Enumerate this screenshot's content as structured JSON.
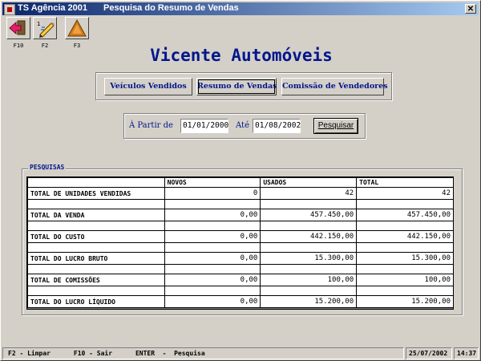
{
  "window": {
    "title_app": "TS Agência 2001",
    "title_screen": "Pesquisa do Resumo de Vendas",
    "close_symbol": "✕"
  },
  "toolbar": {
    "buttons": [
      {
        "icon": "exit-door-arrow-icon",
        "key": "F10"
      },
      {
        "icon": "eraser-pencil-icon",
        "key": "F2"
      },
      {
        "icon": "triangle-icon",
        "key": "F3"
      }
    ]
  },
  "heading": "Vicente Automóveis",
  "nav": {
    "items": [
      {
        "label": "Veículos Vendidos"
      },
      {
        "label": "Resumo de Vendas"
      },
      {
        "label": "Comissão de Vendedores"
      }
    ]
  },
  "filter": {
    "from_label": "À Partir de",
    "from_value": "01/01/2000",
    "to_label": "Até",
    "to_value": "01/08/2002",
    "search_label": "Pesquisar"
  },
  "results": {
    "group_label": "PESQUISAS",
    "columns": [
      "NOVOS",
      "USADOS",
      "TOTAL"
    ],
    "rows": [
      {
        "label": "TOTAL DE UNIDADES VENDIDAS",
        "novos": "0",
        "usados": "42",
        "total": "42"
      },
      {
        "label": "TOTAL DA VENDA",
        "novos": "0,00",
        "usados": "457.450,00",
        "total": "457.450,00"
      },
      {
        "label": "TOTAL DO CUSTO",
        "novos": "0,00",
        "usados": "442.150,00",
        "total": "442.150,00"
      },
      {
        "label": "TOTAL DO LUCRO BRUTO",
        "novos": "0,00",
        "usados": "15.300,00",
        "total": "15.300,00"
      },
      {
        "label": "TOTAL DE COMISSÕES",
        "novos": "0,00",
        "usados": "100,00",
        "total": "100,00"
      },
      {
        "label": "TOTAL DO LUCRO LÍQUIDO",
        "novos": "0,00",
        "usados": "15.200,00",
        "total": "15.200,00"
      }
    ]
  },
  "statusbar": {
    "hints": "F2 - Limpar      F10 - Sair      ENTER  -  Pesquisa",
    "date": "25/07/2002",
    "time": "14:37"
  },
  "colors": {
    "accent": "#00168c",
    "title_gradient_start": "#0a246a",
    "title_gradient_end": "#a6caf0",
    "face": "#d4d0c8"
  }
}
